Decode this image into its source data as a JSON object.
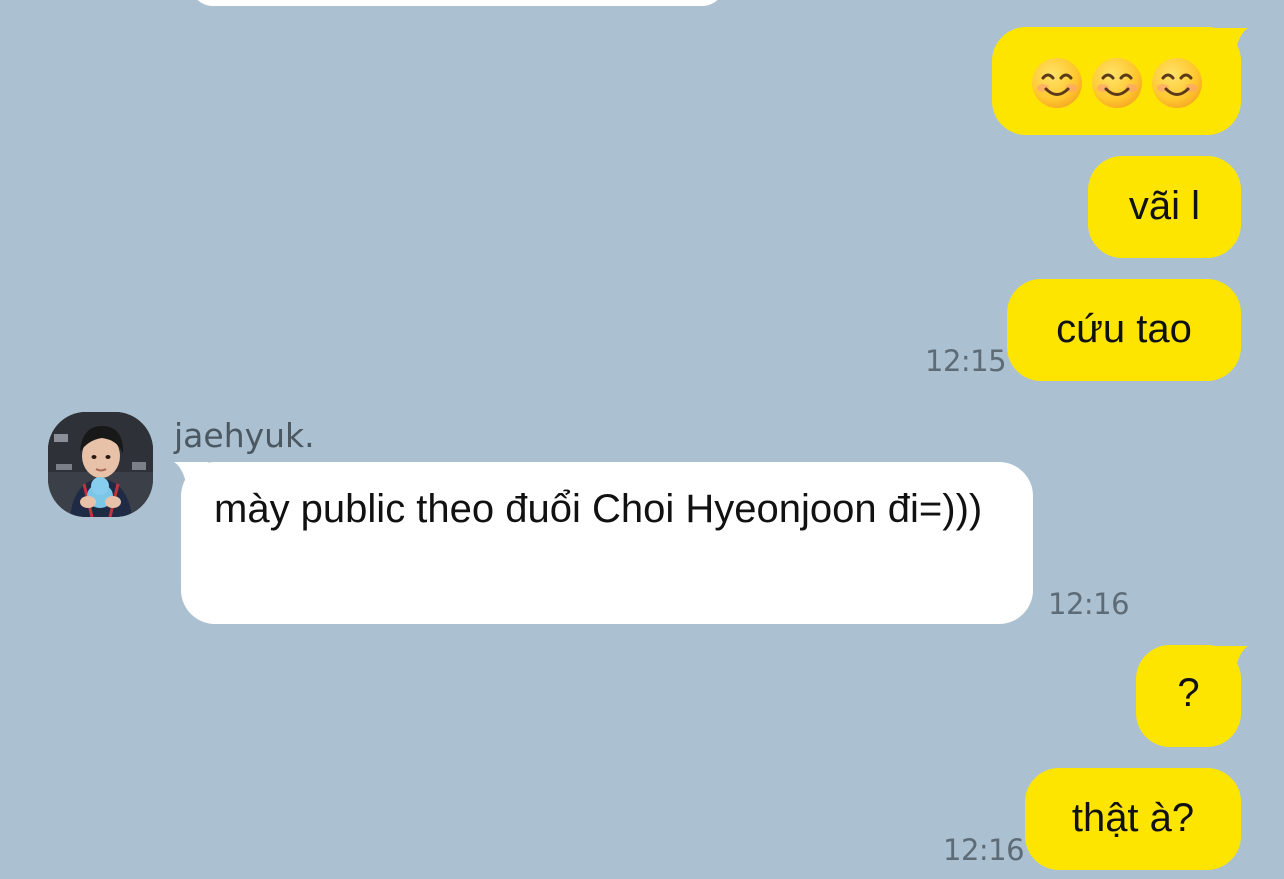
{
  "chat": {
    "messages": [
      {
        "id": "m1",
        "direction": "outgoing",
        "emoji": [
          "smiling-face-icon",
          "smiling-face-icon",
          "smiling-face-icon"
        ]
      },
      {
        "id": "m2",
        "direction": "outgoing",
        "text": "vãi l"
      },
      {
        "id": "m3",
        "direction": "outgoing",
        "text": "cứu tao",
        "time": "12:15"
      },
      {
        "id": "m4",
        "direction": "incoming",
        "sender": "jaehyuk.",
        "text": "mày public theo đuổi Choi Hyeonjoon đi=)))",
        "time": "12:16"
      },
      {
        "id": "m5",
        "direction": "outgoing",
        "text": "?"
      },
      {
        "id": "m6",
        "direction": "outgoing",
        "text": "thật à?",
        "time": "12:16"
      }
    ]
  },
  "colors": {
    "background": "#abc1d1",
    "outgoing_bubble": "#fee500",
    "incoming_bubble": "#ffffff",
    "timestamp": "#5d6b76"
  }
}
